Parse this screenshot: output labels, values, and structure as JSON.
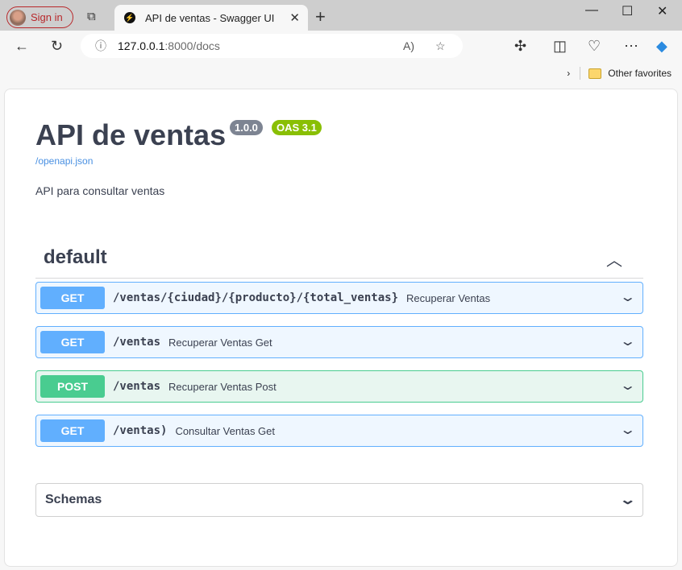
{
  "browser": {
    "sign_in": "Sign in",
    "tab_title": "API de ventas - Swagger UI",
    "url_host": "127.0.0.1",
    "url_rest": ":8000/docs",
    "other_favorites": "Other favorites"
  },
  "header": {
    "title": "API de ventas",
    "version": "1.0.0",
    "oas": "OAS 3.1",
    "spec_link": "/openapi.json",
    "description": "API para consultar ventas"
  },
  "section": {
    "name": "default"
  },
  "operations": [
    {
      "method": "GET",
      "path": "/ventas/{ciudad}/{producto}/{total_ventas}",
      "summary": "Recuperar Ventas"
    },
    {
      "method": "GET",
      "path": "/ventas",
      "summary": "Recuperar Ventas Get"
    },
    {
      "method": "POST",
      "path": "/ventas",
      "summary": "Recuperar Ventas Post"
    },
    {
      "method": "GET",
      "path": "/ventas)",
      "summary": "Consultar Ventas Get"
    }
  ],
  "schemas": {
    "label": "Schemas"
  },
  "colors": {
    "get": "#61affe",
    "post": "#49cc90",
    "version_badge": "#7d8492",
    "oas_badge": "#89bf04"
  }
}
